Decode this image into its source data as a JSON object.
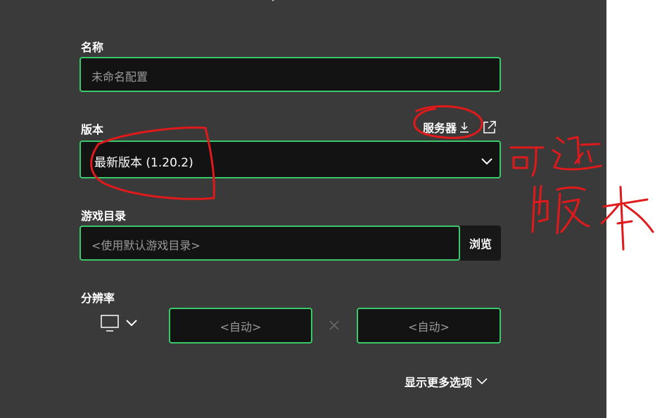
{
  "form": {
    "name": {
      "label": "名称",
      "placeholder": "未命名配置"
    },
    "version": {
      "label": "版本",
      "server_link": "服务器",
      "selected": "最新版本 (1.20.2)"
    },
    "game_dir": {
      "label": "游戏目录",
      "placeholder": "<使用默认游戏目录>",
      "browse_label": "浏览"
    },
    "resolution": {
      "label": "分辨率",
      "width_placeholder": "<自动>",
      "height_placeholder": "<自动>"
    },
    "more_options_label": "显示更多选项"
  },
  "annotation": {
    "handwritten_note": "可选版本",
    "ink_color": "#e0191b"
  },
  "colors": {
    "panel_bg": "#3a3a3a",
    "field_bg": "#131313",
    "accent_green": "#3ac96a"
  },
  "icons": {
    "server_download": "download-icon",
    "external": "external-link-icon",
    "dropdown": "chevron-down-icon",
    "monitor": "monitor-icon",
    "times": "times-icon"
  }
}
